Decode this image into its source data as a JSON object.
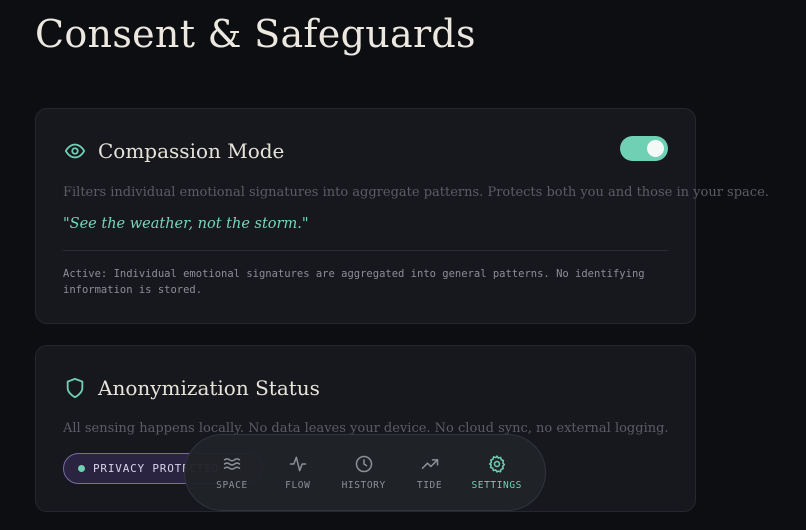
{
  "page": {
    "title": "Consent & Safeguards"
  },
  "compassion": {
    "title": "Compassion Mode",
    "icon": "eye-icon",
    "toggle_on": true,
    "description": "Filters individual emotional signatures into aggregate patterns. Protects both you and those in your space.",
    "quote": "\"See the weather, not the storm.\"",
    "status": "Active: Individual emotional signatures are aggregated into general patterns. No identifying information is stored."
  },
  "anonymization": {
    "title": "Anonymization Status",
    "icon": "shield-icon",
    "description": "All sensing happens locally. No data leaves your device. No cloud sync, no external logging.",
    "badge": "PRIVACY PROTECTED"
  },
  "nav": {
    "items": [
      {
        "label": "SPACE",
        "icon": "waves-icon",
        "active": false
      },
      {
        "label": "FLOW",
        "icon": "pulse-icon",
        "active": false
      },
      {
        "label": "HISTORY",
        "icon": "clock-icon",
        "active": false
      },
      {
        "label": "TIDE",
        "icon": "trend-icon",
        "active": false
      },
      {
        "label": "SETTINGS",
        "icon": "gear-icon",
        "active": true
      }
    ]
  },
  "colors": {
    "accent": "#6fd0b3",
    "background": "#0d0e12",
    "card": "#17181d",
    "badge_border": "#7a68a8"
  }
}
